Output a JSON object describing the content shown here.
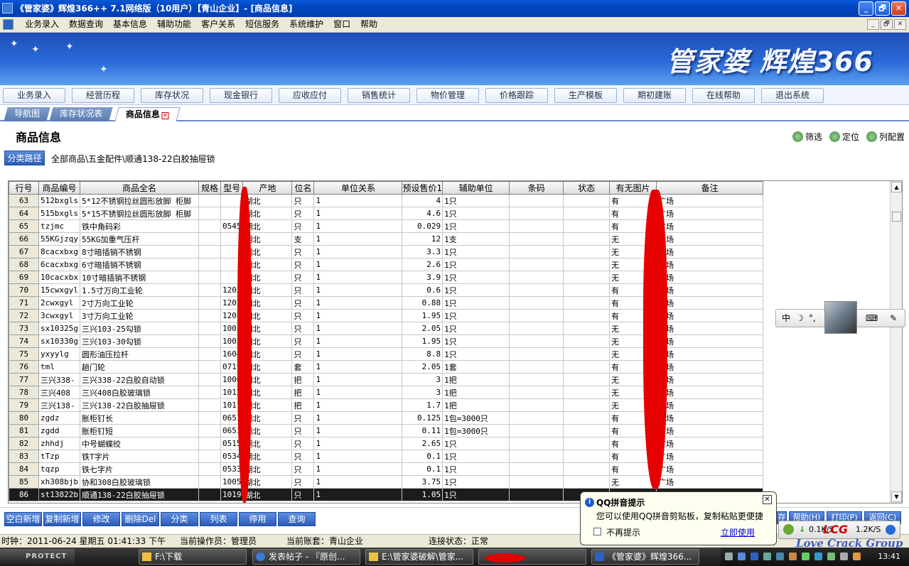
{
  "window": {
    "title": "《管家婆》辉煌366++ 7.1网络版（10用户）【青山企业】- [商品信息]",
    "minimize": "_",
    "maximize": "🗗",
    "close": "✕"
  },
  "menubar": {
    "items": [
      "业务录入",
      "数据查询",
      "基本信息",
      "辅助功能",
      "客户关系",
      "短信服务",
      "系统维护",
      "窗口",
      "帮助"
    ],
    "mdi_minimize": "_",
    "mdi_restore": "🗗",
    "mdi_close": "✕"
  },
  "banner": {
    "logo_text": "管家婆 辉煌366"
  },
  "navbar": {
    "items": [
      "业务录入",
      "经营历程",
      "库存状况",
      "现金银行",
      "应收应付",
      "销售统计",
      "物价管理",
      "价格跟踪",
      "生产模板",
      "期初建账",
      "在线帮助",
      "退出系统"
    ]
  },
  "tabs": {
    "items": [
      "导航图",
      "库存状况表",
      "商品信息"
    ],
    "close_glyph": "✕"
  },
  "page": {
    "title": "商品信息",
    "tools": [
      "筛选",
      "定位",
      "列配置"
    ],
    "path_button": "分类路径",
    "path_text": "全部商品\\五金配件\\顺通138-22白胶抽屉锁"
  },
  "grid": {
    "columns": [
      "行号",
      "商品编号",
      "商品全名",
      "规格",
      "型号",
      "产地",
      "位名",
      "单位关系",
      "预设售价1",
      "辅助单位",
      "条码",
      "状态",
      "有无图片",
      "备注"
    ],
    "rows": [
      [
        "63",
        "512bxgls",
        "5*12不锈钢拉丝圆形放脚 柜脚",
        "",
        "",
        "湖北",
        "只",
        "1",
        "4",
        "1只",
        "",
        "",
        "有",
        "广场"
      ],
      [
        "64",
        "515bxgls",
        "5*15不锈钢拉丝圆形放脚 柜脚",
        "",
        "",
        "湖北",
        "只",
        "1",
        "4.6",
        "1只",
        "",
        "",
        "有",
        "广场"
      ],
      [
        "65",
        "tzjmc",
        "铁中角码彩",
        "",
        "0545",
        "湖北",
        "只",
        "1",
        "0.029",
        "1只",
        "",
        "",
        "有",
        "广场"
      ],
      [
        "66",
        "55KGjzqy",
        "55KG加重气压杆",
        "",
        "",
        "湖北",
        "支",
        "1",
        "12",
        "1支",
        "",
        "",
        "无",
        "广场"
      ],
      [
        "67",
        "8cacxbxg",
        "8寸暗插销不锈钢",
        "",
        "",
        "湖北",
        "只",
        "1",
        "3.3",
        "1只",
        "",
        "",
        "无",
        "广场"
      ],
      [
        "68",
        "6cacxbxg",
        "6寸暗插销不锈钢",
        "",
        "",
        "湖北",
        "只",
        "1",
        "2.6",
        "1只",
        "",
        "",
        "无",
        "广场"
      ],
      [
        "69",
        "10cacxbx",
        "10寸暗插销不锈钢",
        "",
        "",
        "湖北",
        "只",
        "1",
        "3.9",
        "1只",
        "",
        "",
        "无",
        "广场"
      ],
      [
        "70",
        "15cwxgyl",
        "1.5寸万向工业轮",
        "",
        "1203",
        "湖北",
        "只",
        "1",
        "0.6",
        "1只",
        "",
        "",
        "有",
        "广场"
      ],
      [
        "71",
        "2cwxgyl",
        "2寸万向工业轮",
        "",
        "1202",
        "湖北",
        "只",
        "1",
        "0.88",
        "1只",
        "",
        "",
        "有",
        "广场"
      ],
      [
        "72",
        "3cwxgyl",
        "3寸万向工业轮",
        "",
        "1208",
        "湖北",
        "只",
        "1",
        "1.95",
        "1只",
        "",
        "",
        "有",
        "广场"
      ],
      [
        "73",
        "sx10325g",
        "三兴103-25勾锁",
        "",
        "1003",
        "湖北",
        "只",
        "1",
        "2.05",
        "1只",
        "",
        "",
        "无",
        "广场"
      ],
      [
        "74",
        "sx10330g",
        "三兴103-30勾锁",
        "",
        "1003",
        "湖北",
        "只",
        "1",
        "1.95",
        "1只",
        "",
        "",
        "无",
        "广场"
      ],
      [
        "75",
        "yxyylg",
        "圆形油压拉杆",
        "",
        "1604",
        "湖北",
        "只",
        "1",
        "8.8",
        "1只",
        "",
        "",
        "无",
        "广场"
      ],
      [
        "76",
        "tml",
        "趟门轮",
        "",
        "0719",
        "湖北",
        "套",
        "1",
        "2.05",
        "1套",
        "",
        "",
        "有",
        "广场"
      ],
      [
        "77",
        "三兴338-",
        "三兴338-22白胶自动锁",
        "",
        "1006",
        "湖北",
        "把",
        "1",
        "3",
        "1把",
        "",
        "",
        "无",
        "广场"
      ],
      [
        "78",
        "三兴408",
        "三兴408白胶玻璃锁",
        "",
        "1012",
        "湖北",
        "把",
        "1",
        "3",
        "1把",
        "",
        "",
        "无",
        "广场"
      ],
      [
        "79",
        "三兴138-",
        "三兴138-22白胶抽屉锁",
        "",
        "1011",
        "湖北",
        "把",
        "1",
        "1.7",
        "1把",
        "",
        "",
        "无",
        "广场"
      ],
      [
        "80",
        "zgdz",
        "胀柜钉长",
        "",
        "0651",
        "湖北",
        "只",
        "1",
        "0.125",
        "1包=3000只",
        "",
        "",
        "有",
        "广场"
      ],
      [
        "81",
        "zgdd",
        "胀柜钉短",
        "",
        "0651",
        "湖北",
        "只",
        "1",
        "0.11",
        "1包=3000只",
        "",
        "",
        "有",
        "广场"
      ],
      [
        "82",
        "zhhdj",
        "中号蝴蝶绞",
        "",
        "0515",
        "湖北",
        "只",
        "1",
        "2.65",
        "1只",
        "",
        "",
        "有",
        "广场"
      ],
      [
        "83",
        "tTzp",
        "铁T字片",
        "",
        "0534",
        "湖北",
        "只",
        "1",
        "0.1",
        "1只",
        "",
        "",
        "有",
        "广场"
      ],
      [
        "84",
        "tqzp",
        "铁七字片",
        "",
        "0533",
        "湖北",
        "只",
        "1",
        "0.1",
        "1只",
        "",
        "",
        "有",
        "广场"
      ],
      [
        "85",
        "xh308bjb",
        "协和308白胶玻璃锁",
        "",
        "1005",
        "湖北",
        "只",
        "1",
        "3.75",
        "1只",
        "",
        "",
        "无",
        "广场"
      ],
      [
        "86",
        "st13822b",
        "顺通138-22白胶抽屉锁",
        "",
        "1019",
        "湖北",
        "只",
        "1",
        "1.05",
        "1只",
        "",
        "",
        "",
        ""
      ]
    ]
  },
  "toolbar": {
    "buttons": [
      "空白新增",
      "复制新增",
      "修改",
      "删除Del",
      "分类",
      "列表",
      "停用",
      "查询"
    ],
    "right_buttons": [
      "存",
      "帮助(H)",
      "打印(P)",
      "返回(C)"
    ]
  },
  "statusbar": {
    "time": "时钟：2011-06-24 星期五 01:41:33 下午",
    "operator": "当前操作员：管理员",
    "account": "当前账套：青山企业",
    "connection": "连接状态：正常"
  },
  "ime": {
    "mode": "中",
    "moon": "☽",
    "punct": "°,",
    "keyboard": "⌨",
    "tools": "✎"
  },
  "qq_popup": {
    "info_icon": "i",
    "title": "QQ拼音提示",
    "message": "您可以使用QQ拼音剪贴板，复制粘贴更便捷",
    "checkbox_label": "不再提示",
    "link": "立即使用",
    "close": "✕"
  },
  "netwidget": {
    "down": "↓",
    "down_rate": "0.1K/S",
    "up_rate": "1.2K/S"
  },
  "watermark": {
    "badge": "LCG",
    "text": "Love Crack Group"
  },
  "taskbar": {
    "start": "PROTECT",
    "tasks": [
      "F:\\下载",
      "发表帖子 - 『原创...",
      "E:\\管家婆破解\\管家...",
      "",
      "《管家婆》辉煌366..."
    ],
    "clock": "13:41"
  }
}
